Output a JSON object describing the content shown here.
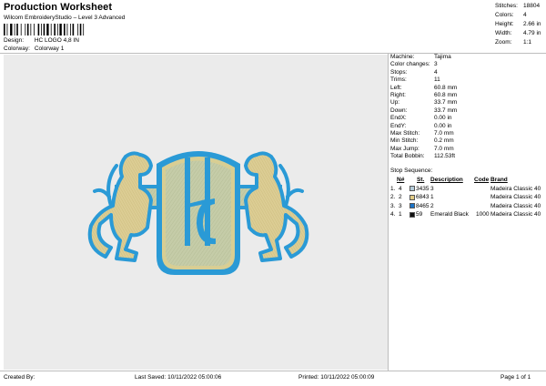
{
  "header": {
    "title": "Production Worksheet",
    "subtitle": "Wilcom EmbroideryStudio – Level 3 Advanced",
    "design_label": "Design:",
    "design_value": "HC LOGO 4,8 IN",
    "colorway_label": "Colorway:",
    "colorway_value": "Colorway 1"
  },
  "top_stats": [
    {
      "label": "Stitches:",
      "value": "18804"
    },
    {
      "label": "Colors:",
      "value": "4"
    },
    {
      "label": "Height:",
      "value": "2.66 in"
    },
    {
      "label": "Width:",
      "value": "4.79 in"
    },
    {
      "label": "Zoom:",
      "value": "1:1"
    }
  ],
  "machine_info": [
    {
      "label": "Machine:",
      "value": "Tajima"
    },
    {
      "label": "Color changes:",
      "value": "3"
    },
    {
      "label": "Stops:",
      "value": "4"
    },
    {
      "label": "Trims:",
      "value": "11"
    },
    {
      "label": "Left:",
      "value": "60.8 mm"
    },
    {
      "label": "Right:",
      "value": "60.8 mm"
    },
    {
      "label": "Up:",
      "value": "33.7 mm"
    },
    {
      "label": "Down:",
      "value": "33.7 mm"
    },
    {
      "label": "EndX:",
      "value": "0.00 in"
    },
    {
      "label": "EndY:",
      "value": "0.00 in"
    },
    {
      "label": "Max Stitch:",
      "value": "7.0 mm"
    },
    {
      "label": "Min Stitch:",
      "value": "0.2 mm"
    },
    {
      "label": "Max Jump:",
      "value": "7.0 mm"
    },
    {
      "label": "Total Bobbin:",
      "value": "112.53ft"
    }
  ],
  "stop_sequence": {
    "title": "Stop Sequence:",
    "headers": {
      "n": "N#",
      "st": "St.",
      "description": "Description",
      "code": "Code",
      "brand": "Brand"
    },
    "rows": [
      {
        "idx": "1.",
        "n": "4",
        "swatch": "#b5ccd9",
        "st": "3435",
        "description": "3",
        "code": "",
        "brand": "Madeira Classic 40"
      },
      {
        "idx": "2.",
        "n": "2",
        "swatch": "#e2cc86",
        "st": "6843",
        "description": "1",
        "code": "",
        "brand": "Madeira Classic 40"
      },
      {
        "idx": "3.",
        "n": "3",
        "swatch": "#1a73c8",
        "st": "8465",
        "description": "2",
        "code": "",
        "brand": "Madeira Classic 40"
      },
      {
        "idx": "4.",
        "n": "1",
        "swatch": "#111111",
        "st": "59",
        "description": "Emerald Black",
        "code": "1000",
        "brand": "Madeira Classic 40"
      }
    ]
  },
  "footer": {
    "created_by": "Created By:",
    "last_saved": "Last Saved: 10/11/2022 05:00:06",
    "printed": "Printed: 10/11/2022 05:00:09",
    "page": "Page 1 of 1"
  },
  "colors": {
    "blue": "#2a9ad6",
    "gold": "#d8c98f",
    "sage": "#c2c9a4",
    "canvas": "#ebebeb"
  }
}
